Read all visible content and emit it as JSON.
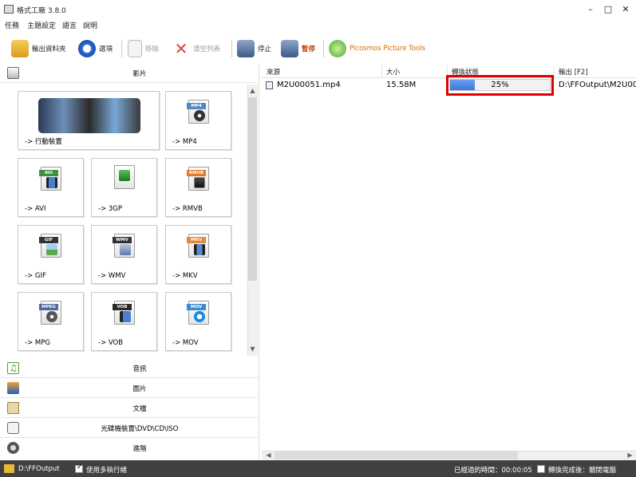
{
  "window": {
    "title": "格式工廠 3.8.0",
    "controls": {
      "minimize": "–",
      "maximize": "□",
      "close": "✕"
    }
  },
  "menu": [
    "任務",
    "主題設定",
    "語言",
    "說明"
  ],
  "toolbar": {
    "output_folder": "輸出資料夾",
    "options": "選項",
    "remove": "移除",
    "clear_list": "清空列表",
    "stop": "停止",
    "pause": "暫停",
    "picosmos": "Picosmos Picture Tools"
  },
  "left_panel": {
    "video_header": "影片",
    "video_tiles": [
      {
        "label": "-> 行動裝置",
        "tag": "",
        "icon": "mobile-devices-icon"
      },
      {
        "label": "-> MP4",
        "tag": "MP4",
        "icon": "mp4-file-icon"
      },
      {
        "label": "-> AVI",
        "tag": "AVI",
        "icon": "avi-file-icon"
      },
      {
        "label": "-> 3GP",
        "tag": "",
        "icon": "3gp-file-icon"
      },
      {
        "label": "-> RMVB",
        "tag": "RMVB",
        "icon": "rmvb-file-icon"
      },
      {
        "label": "-> GIF",
        "tag": "GIF",
        "icon": "gif-file-icon"
      },
      {
        "label": "-> WMV",
        "tag": "WMV",
        "icon": "wmv-file-icon"
      },
      {
        "label": "-> MKV",
        "tag": "MKV",
        "icon": "mkv-file-icon"
      },
      {
        "label": "-> MPG",
        "tag": "MPEG",
        "icon": "mpg-file-icon"
      },
      {
        "label": "-> VOB",
        "tag": "VOB",
        "icon": "vob-file-icon"
      },
      {
        "label": "-> MOV",
        "tag": "MOV",
        "icon": "mov-file-icon"
      }
    ],
    "categories": [
      {
        "label": "音訊",
        "icon": "music-note-icon"
      },
      {
        "label": "圖片",
        "icon": "picture-icon"
      },
      {
        "label": "文檔",
        "icon": "document-icon"
      },
      {
        "label": "光碟機裝置\\DVD\\CD\\ISO",
        "icon": "disc-drive-icon"
      },
      {
        "label": "進階",
        "icon": "advanced-tools-icon"
      }
    ]
  },
  "task_list": {
    "columns": {
      "source": "來源",
      "size": "大小",
      "status": "轉換狀態",
      "output": "輸出 [F2]"
    },
    "rows": [
      {
        "source": "M2U00051.mp4",
        "size": "15.58M",
        "progress": 25,
        "progress_text": "25%",
        "output": "D:\\FFOutput\\M2U00"
      }
    ]
  },
  "statusbar": {
    "output_path": "D:\\FFOutput",
    "multithread_label": "使用多執行緒",
    "elapsed": "已經過的時間：00:00:05",
    "after_convert": "轉換完成後：關閉電腦"
  },
  "colors": {
    "highlight_box": "#e00000",
    "progress_fill": "#3f76d8",
    "statusbar_bg": "#404040"
  }
}
